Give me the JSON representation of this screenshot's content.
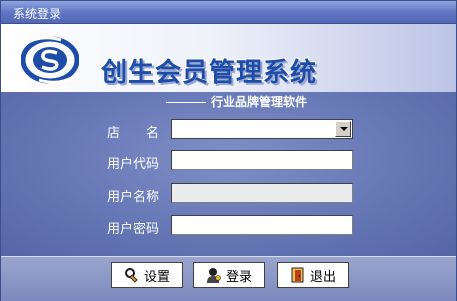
{
  "window": {
    "title": "系统登录"
  },
  "header": {
    "app_title": "创生会员管理系统",
    "subtitle": "行业品牌管理软件"
  },
  "form": {
    "store": {
      "label": "店　　名",
      "value": ""
    },
    "user_code": {
      "label": "用户代码",
      "value": ""
    },
    "user_name": {
      "label": "用户名称",
      "value": ""
    },
    "password": {
      "label": "用户密码",
      "value": ""
    }
  },
  "buttons": {
    "settings": {
      "label": "设置",
      "icon": "settings-icon"
    },
    "login": {
      "label": "登录",
      "icon": "user-login-icon"
    },
    "exit": {
      "label": "退出",
      "icon": "exit-door-icon"
    }
  },
  "colors": {
    "title_text": "#1d4da8",
    "panel": "#6b7bb3",
    "titlebar": "#6277c4"
  }
}
